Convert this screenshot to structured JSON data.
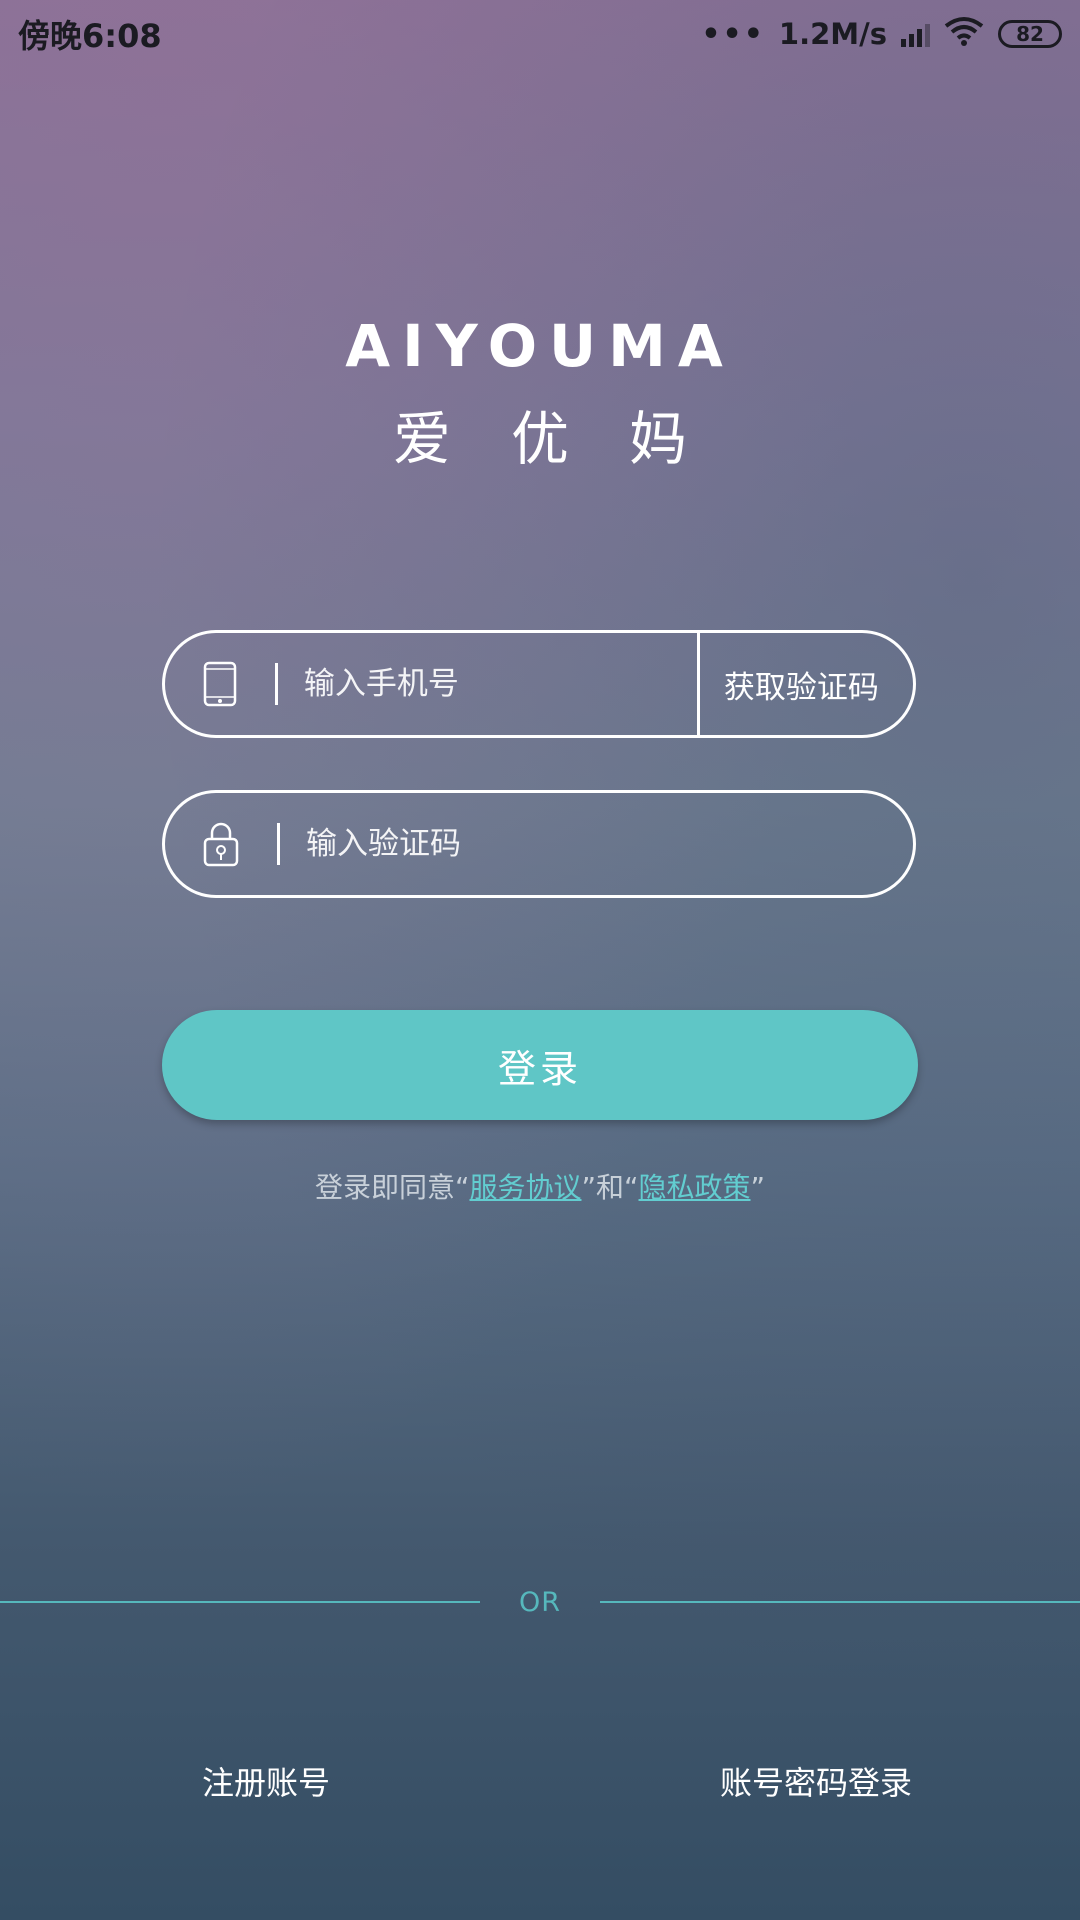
{
  "status_bar": {
    "time": "傍晚6:08",
    "dots": "•••",
    "network_speed": "1.2M/s",
    "battery": "82"
  },
  "logo": {
    "english": "AIYOUMA",
    "chinese": "爱优妈"
  },
  "phone_field": {
    "placeholder": "输入手机号",
    "icon": "phone-icon",
    "get_code_label": "获取验证码"
  },
  "code_field": {
    "placeholder": "输入验证码",
    "icon": "lock-icon"
  },
  "login_button": {
    "label": "登录"
  },
  "agreement": {
    "prefix": "登录即同意“",
    "service_link": "服务协议",
    "middle": "”和“",
    "privacy_link": "隐私政策",
    "suffix": "”"
  },
  "divider": {
    "label": "OR"
  },
  "bottom": {
    "register_label": "注册账号",
    "password_login_label": "账号密码登录"
  },
  "colors": {
    "accent": "#5fc6c6",
    "link": "#62cdd0"
  }
}
